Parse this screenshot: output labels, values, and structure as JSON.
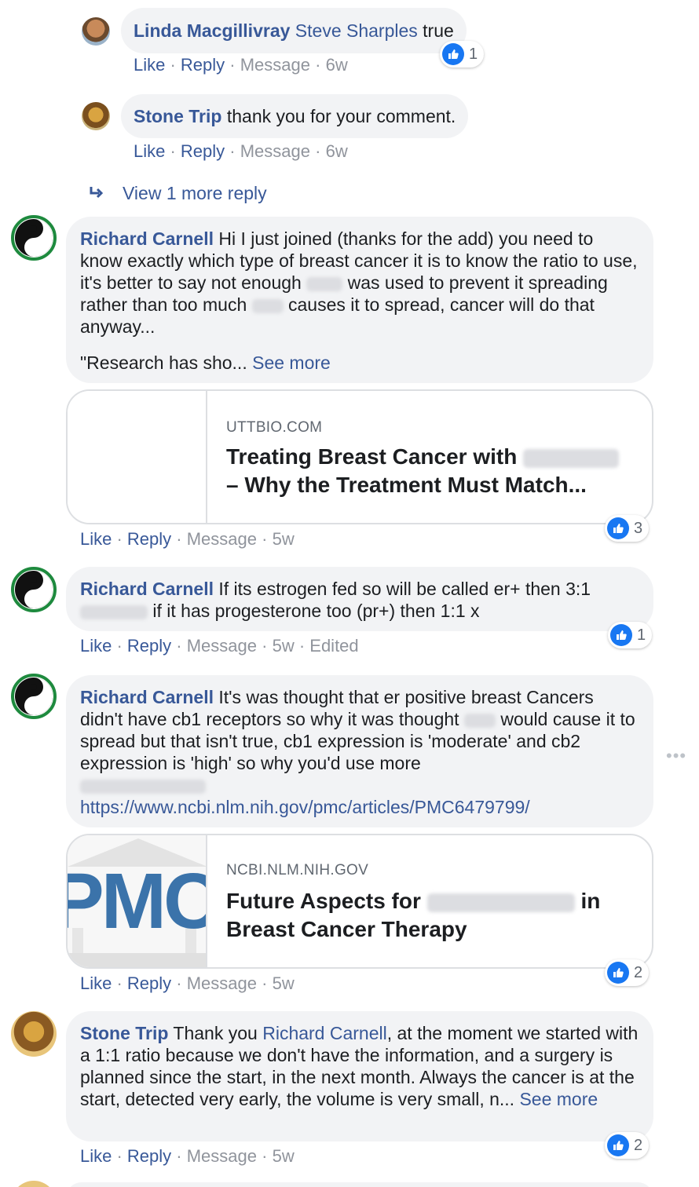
{
  "comments": [
    {
      "author": "Linda Macgillivray",
      "mention": "Steve Sharples",
      "text": " true",
      "actions": {
        "like": "Like",
        "reply": "Reply",
        "message": "Message",
        "time": "6w"
      },
      "reactions": "1"
    },
    {
      "author": "Stone Trip",
      "text": " thank you for your comment.",
      "actions": {
        "like": "Like",
        "reply": "Reply",
        "message": "Message",
        "time": "6w"
      }
    },
    {
      "author": "Richard Carnell",
      "text_a": " Hi I just joined (thanks for the add) you need to know exactly which type of breast cancer it is to know the ratio to use, it's better to say not enough ",
      "text_b": " was used to prevent it spreading rather than too much ",
      "text_c": " causes it to spread, cancer will do that anyway...",
      "quote": "\"Research has sho... ",
      "see_more": "See more",
      "card": {
        "domain": "UTTBIO.COM",
        "title_a": "Treating Breast Cancer with ",
        "title_b": "– Why the Treatment Must Match..."
      },
      "actions": {
        "like": "Like",
        "reply": "Reply",
        "message": "Message",
        "time": "5w"
      },
      "reactions": "3"
    },
    {
      "author": "Richard Carnell",
      "text_a": " If its estrogen fed so will be called er+ then 3:1",
      "text_b": " if it has progesterone too (pr+) then 1:1 x",
      "actions": {
        "like": "Like",
        "reply": "Reply",
        "message": "Message",
        "time": "5w",
        "edited": "Edited"
      },
      "reactions": "1"
    },
    {
      "author": "Richard Carnell",
      "text_a": " It's was thought that er positive breast Cancers didn't have cb1 receptors so why it was thought ",
      "text_b": " would cause it to spread but that isn't true, cb1 expression is 'moderate' and cb2 expression is 'high' so why you'd use more",
      "url": "https://www.ncbi.nlm.nih.gov/pmc/articles/PMC6479799/",
      "card": {
        "domain": "NCBI.NLM.NIH.GOV",
        "title_a": "Future Aspects for ",
        "title_b": " in",
        "title_c": "Breast Cancer Therapy",
        "thumb_text": "PMC"
      },
      "actions": {
        "like": "Like",
        "reply": "Reply",
        "message": "Message",
        "time": "5w"
      },
      "reactions": "2"
    },
    {
      "author": "Stone Trip",
      "text_a": " Thank you ",
      "mention": "Richard Carnell",
      "text_b": ", at the moment we started with a 1:1 ratio because we don't have the information, and a surgery is planned since the start, in the next month. Always the cancer is at the start, detected very early, the volume is very small, n... ",
      "see_more": "See more",
      "actions": {
        "like": "Like",
        "reply": "Reply",
        "message": "Message",
        "time": "5w"
      },
      "reactions": "2"
    }
  ],
  "view_more_replies": "View 1 more reply",
  "more_options_icon": "more-horizontal-icon",
  "colors": {
    "link": "#385898",
    "bubble": "#f2f3f5",
    "like_blue": "#1877f2",
    "meta": "#90949c"
  }
}
